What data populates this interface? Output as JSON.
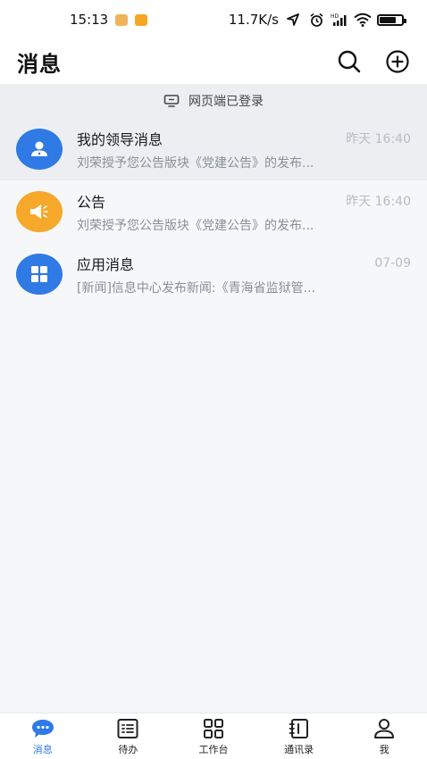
{
  "status_bar": {
    "time": "15:13",
    "network_speed": "11.7K/s",
    "icons": [
      "location-icon",
      "alarm-icon",
      "hd-signal-icon",
      "wifi-icon",
      "battery-icon"
    ]
  },
  "header": {
    "title": "消息",
    "icons": [
      "search-icon",
      "add-circle-icon"
    ]
  },
  "banner": {
    "icon": "monitor-icon",
    "text": "网页端已登录"
  },
  "messages": [
    {
      "title": "我的领导消息",
      "time": "昨天 16:40",
      "preview": "刘荣授予您公告版块《党建公告》的发布...",
      "icon": "user-icon",
      "color": "#2f7ae5"
    },
    {
      "title": "公告",
      "time": "昨天 16:40",
      "preview": "刘荣授予您公告版块《党建公告》的发布...",
      "icon": "megaphone-icon",
      "color": "#f6a82a"
    },
    {
      "title": "应用消息",
      "time": "07-09",
      "preview": "[新闻]信息中心发布新闻:《青海省监狱管...",
      "icon": "apps-grid-icon",
      "color": "#2f7ae5"
    }
  ],
  "bottom_nav": [
    {
      "label": "消息",
      "icon": "chat-bubble-icon",
      "active": true
    },
    {
      "label": "待办",
      "icon": "list-icon",
      "active": false
    },
    {
      "label": "工作台",
      "icon": "grid-icon",
      "active": false
    },
    {
      "label": "通讯录",
      "icon": "contacts-book-icon",
      "active": false
    },
    {
      "label": "我",
      "icon": "profile-icon",
      "active": false
    }
  ],
  "colors": {
    "accent": "#2f7ae5",
    "announcement": "#f6a82a",
    "background": "#f6f7f9"
  }
}
